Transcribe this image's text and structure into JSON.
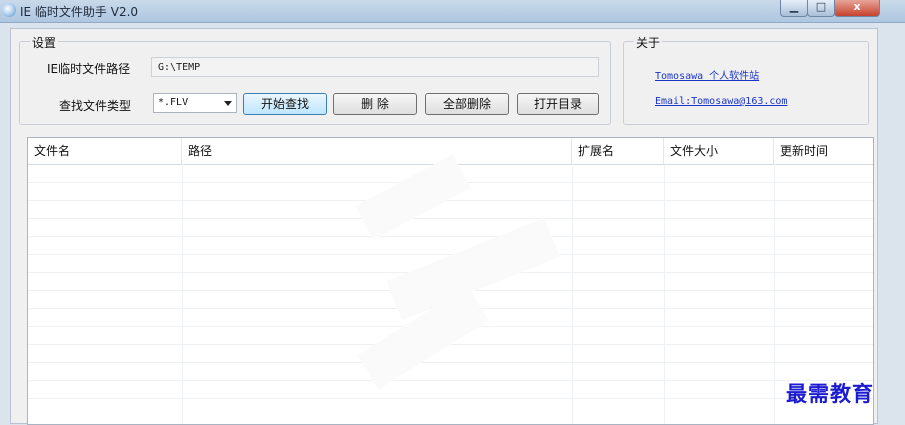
{
  "window": {
    "title": "IE 临时文件助手 V2.0",
    "minimize_glyph": "▁",
    "maximize_glyph": "□",
    "close_glyph": "x"
  },
  "settings": {
    "group_title": "设置",
    "path_label": "IE临时文件路径",
    "path_value": "G:\\TEMP",
    "type_label": "查找文件类型",
    "type_value": "*.FLV"
  },
  "buttons": {
    "search": "开始查找",
    "delete": "删 除",
    "delete_all": "全部删除",
    "open_dir": "打开目录"
  },
  "about": {
    "group_title": "关于",
    "site_link": "Tomosawa 个人软件站",
    "email_link": "Email:Tomosawa@163.com"
  },
  "list": {
    "columns": [
      "文件名",
      "路径",
      "扩展名",
      "文件大小",
      "更新时间"
    ]
  },
  "watermark": "最需教育",
  "colors": {
    "accent_button": "#bee6fd",
    "link": "#1a35c8",
    "watermark": "#1b1bd0"
  }
}
